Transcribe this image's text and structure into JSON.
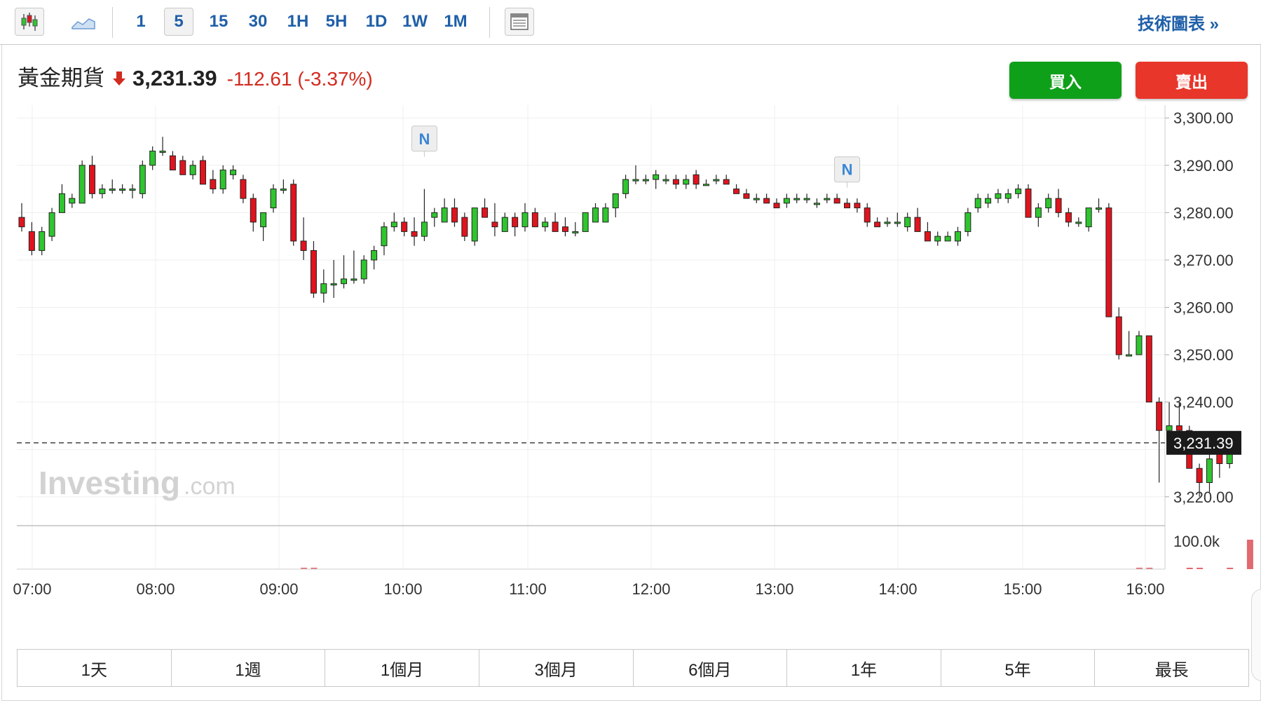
{
  "toolbar": {
    "intervals": [
      "1",
      "5",
      "15",
      "30",
      "1H",
      "5H",
      "1D",
      "1W",
      "1M"
    ],
    "active_interval": "5",
    "technical_link": "技術圖表 »"
  },
  "quote": {
    "name": "黃金期貨",
    "price": "3,231.39",
    "change": "-112.61 (-3.37%)",
    "direction_color": "#d22b20"
  },
  "actions": {
    "buy": "買入",
    "sell": "賣出",
    "buy_color": "#0fa01a",
    "sell_color": "#e8362a"
  },
  "watermark": {
    "brand": "Investing",
    "suffix": ".com"
  },
  "ranges": [
    "1天",
    "1週",
    "1個月",
    "3個月",
    "6個月",
    "1年",
    "5年",
    "最長"
  ],
  "chart_data": {
    "type": "candlestick",
    "title": "黃金期貨",
    "interval": "5",
    "x_ticks": [
      "07:00",
      "08:00",
      "09:00",
      "10:00",
      "11:00",
      "12:00",
      "13:00",
      "14:00",
      "15:00",
      "16:00"
    ],
    "y_ticks": [
      "3,300.00",
      "3,290.00",
      "3,280.00",
      "3,270.00",
      "3,260.00",
      "3,250.00",
      "3,240.00",
      "3,230.00",
      "3,220.00"
    ],
    "y_tick_values": [
      3300,
      3290,
      3280,
      3270,
      3260,
      3250,
      3240,
      3230,
      3220
    ],
    "ylim": [
      3213.9,
      3302.7
    ],
    "current_price": 3231.39,
    "current_price_label": "3,231.39",
    "up_color": "#2fc52f",
    "down_color": "#e0141e",
    "volume_axis_label": "100.0k",
    "news_markers": [
      "N",
      "N"
    ],
    "candles": [
      [
        3279,
        3282,
        3276,
        3277
      ],
      [
        3276,
        3278,
        3271,
        3272
      ],
      [
        3272,
        3277,
        3271,
        3276
      ],
      [
        3275,
        3281,
        3274,
        3280
      ],
      [
        3280,
        3286,
        3280,
        3284
      ],
      [
        3282,
        3284,
        3281,
        3283
      ],
      [
        3282,
        3291,
        3282,
        3290
      ],
      [
        3290,
        3292,
        3283,
        3284
      ],
      [
        3284,
        3286,
        3283,
        3285
      ],
      [
        3285,
        3287,
        3284,
        3285
      ],
      [
        3285,
        3286,
        3284,
        3285
      ],
      [
        3285,
        3286,
        3283,
        3285
      ],
      [
        3284,
        3291,
        3283,
        3290
      ],
      [
        3290,
        3294,
        3289,
        3293
      ],
      [
        3293,
        3296,
        3292,
        3293
      ],
      [
        3292,
        3293,
        3289,
        3289
      ],
      [
        3291,
        3292,
        3288,
        3288
      ],
      [
        3288,
        3291,
        3287,
        3290
      ],
      [
        3291,
        3292,
        3286,
        3286
      ],
      [
        3287,
        3289,
        3284,
        3285
      ],
      [
        3285,
        3290,
        3284,
        3289
      ],
      [
        3288,
        3290,
        3287,
        3289
      ],
      [
        3287,
        3288,
        3282,
        3283
      ],
      [
        3283,
        3284,
        3276,
        3278
      ],
      [
        3277,
        3280,
        3274,
        3280
      ],
      [
        3281,
        3286,
        3280,
        3285
      ],
      [
        3285,
        3287,
        3284,
        3285
      ],
      [
        3286,
        3287,
        3273,
        3274
      ],
      [
        3274,
        3279,
        3270,
        3272
      ],
      [
        3272,
        3274,
        3262,
        3263
      ],
      [
        3263,
        3268,
        3261,
        3265
      ],
      [
        3265,
        3270,
        3262,
        3265
      ],
      [
        3265,
        3271,
        3264,
        3266
      ],
      [
        3266,
        3272,
        3265,
        3266
      ],
      [
        3266,
        3271,
        3265,
        3270
      ],
      [
        3270,
        3273,
        3268,
        3272
      ],
      [
        3273,
        3278,
        3271,
        3277
      ],
      [
        3277,
        3280,
        3276,
        3278
      ],
      [
        3278,
        3279,
        3275,
        3276
      ],
      [
        3276,
        3279,
        3273,
        3275
      ],
      [
        3275,
        3285,
        3274,
        3278
      ],
      [
        3279,
        3281,
        3277,
        3280
      ],
      [
        3278,
        3283,
        3278,
        3281
      ],
      [
        3281,
        3283,
        3277,
        3278
      ],
      [
        3279,
        3280,
        3274,
        3275
      ],
      [
        3274,
        3281,
        3273,
        3281
      ],
      [
        3281,
        3283,
        3279,
        3279
      ],
      [
        3278,
        3282,
        3275,
        3277
      ],
      [
        3276,
        3280,
        3276,
        3279
      ],
      [
        3279,
        3280,
        3275,
        3277
      ],
      [
        3277,
        3282,
        3276,
        3280
      ],
      [
        3280,
        3281,
        3277,
        3277
      ],
      [
        3277,
        3279,
        3276,
        3278
      ],
      [
        3278,
        3280,
        3276,
        3276
      ],
      [
        3277,
        3279,
        3275,
        3276
      ],
      [
        3276,
        3278,
        3275,
        3276
      ],
      [
        3276,
        3280,
        3276,
        3280
      ],
      [
        3278,
        3282,
        3278,
        3281
      ],
      [
        3278,
        3282,
        3278,
        3281
      ],
      [
        3281,
        3284,
        3279,
        3284
      ],
      [
        3284,
        3288,
        3283,
        3287
      ],
      [
        3287,
        3290,
        3286,
        3287
      ],
      [
        3287,
        3288,
        3286,
        3287
      ],
      [
        3287,
        3289,
        3285,
        3288
      ],
      [
        3287,
        3288,
        3286,
        3287
      ],
      [
        3287,
        3288,
        3285,
        3286
      ],
      [
        3286,
        3288,
        3285,
        3287
      ],
      [
        3288,
        3289,
        3285,
        3286
      ],
      [
        3286,
        3287,
        3286,
        3286
      ],
      [
        3287,
        3288,
        3286,
        3287
      ],
      [
        3287,
        3288,
        3286,
        3286
      ],
      [
        3285,
        3286,
        3284,
        3284
      ],
      [
        3284,
        3285,
        3283,
        3283
      ],
      [
        3283,
        3284,
        3282,
        3283
      ],
      [
        3283,
        3284,
        3282,
        3282
      ],
      [
        3282,
        3283,
        3281,
        3281
      ],
      [
        3282,
        3284,
        3281,
        3283
      ],
      [
        3283,
        3284,
        3282,
        3283
      ],
      [
        3283,
        3284,
        3282,
        3283
      ],
      [
        3282,
        3283,
        3281,
        3282
      ],
      [
        3283,
        3284,
        3282,
        3283
      ],
      [
        3283,
        3284,
        3282,
        3282
      ],
      [
        3282,
        3283,
        3281,
        3281
      ],
      [
        3282,
        3283,
        3280,
        3281
      ],
      [
        3281,
        3282,
        3277,
        3278
      ],
      [
        3278,
        3279,
        3277,
        3277
      ],
      [
        3278,
        3279,
        3277,
        3278
      ],
      [
        3278,
        3280,
        3277,
        3278
      ],
      [
        3277,
        3280,
        3276,
        3279
      ],
      [
        3279,
        3281,
        3276,
        3276
      ],
      [
        3276,
        3278,
        3274,
        3274
      ],
      [
        3274,
        3276,
        3273,
        3275
      ],
      [
        3274,
        3276,
        3274,
        3275
      ],
      [
        3274,
        3277,
        3273,
        3276
      ],
      [
        3276,
        3281,
        3275,
        3280
      ],
      [
        3281,
        3284,
        3280,
        3283
      ],
      [
        3282,
        3284,
        3281,
        3283
      ],
      [
        3283,
        3285,
        3282,
        3284
      ],
      [
        3283,
        3285,
        3282,
        3284
      ],
      [
        3284,
        3286,
        3283,
        3285
      ],
      [
        3285,
        3286,
        3279,
        3279
      ],
      [
        3279,
        3282,
        3277,
        3281
      ],
      [
        3281,
        3284,
        3280,
        3283
      ],
      [
        3283,
        3285,
        3279,
        3280
      ],
      [
        3280,
        3281,
        3277,
        3278
      ],
      [
        3278,
        3279,
        3277,
        3278
      ],
      [
        3277,
        3281,
        3276,
        3281
      ],
      [
        3281,
        3283,
        3280,
        3281
      ],
      [
        3281,
        3282,
        3258,
        3258
      ],
      [
        3258,
        3260,
        3249,
        3250
      ],
      [
        3250,
        3255,
        3250,
        3250
      ],
      [
        3250,
        3255,
        3250,
        3254
      ],
      [
        3254,
        3254,
        3240,
        3240
      ],
      [
        3240,
        3241,
        3223,
        3234
      ],
      [
        3234,
        3240,
        3232,
        3235
      ],
      [
        3235,
        3240,
        3233,
        3234
      ],
      [
        3234,
        3235,
        3226,
        3226
      ],
      [
        3226,
        3227,
        3220,
        3223
      ],
      [
        3223,
        3230,
        3221,
        3228
      ],
      [
        3229,
        3232,
        3224,
        3227
      ],
      [
        3227,
        3232,
        3226,
        3231
      ]
    ],
    "volumes": [
      {
        "index": 28,
        "value": 3
      },
      {
        "index": 29,
        "value": 3
      },
      {
        "index": 111,
        "value": 3
      },
      {
        "index": 112,
        "value": 3
      },
      {
        "index": 116,
        "value": 3
      },
      {
        "index": 117,
        "value": 3
      },
      {
        "index": 120,
        "value": 3
      },
      {
        "index": 122,
        "value": 100
      }
    ]
  }
}
